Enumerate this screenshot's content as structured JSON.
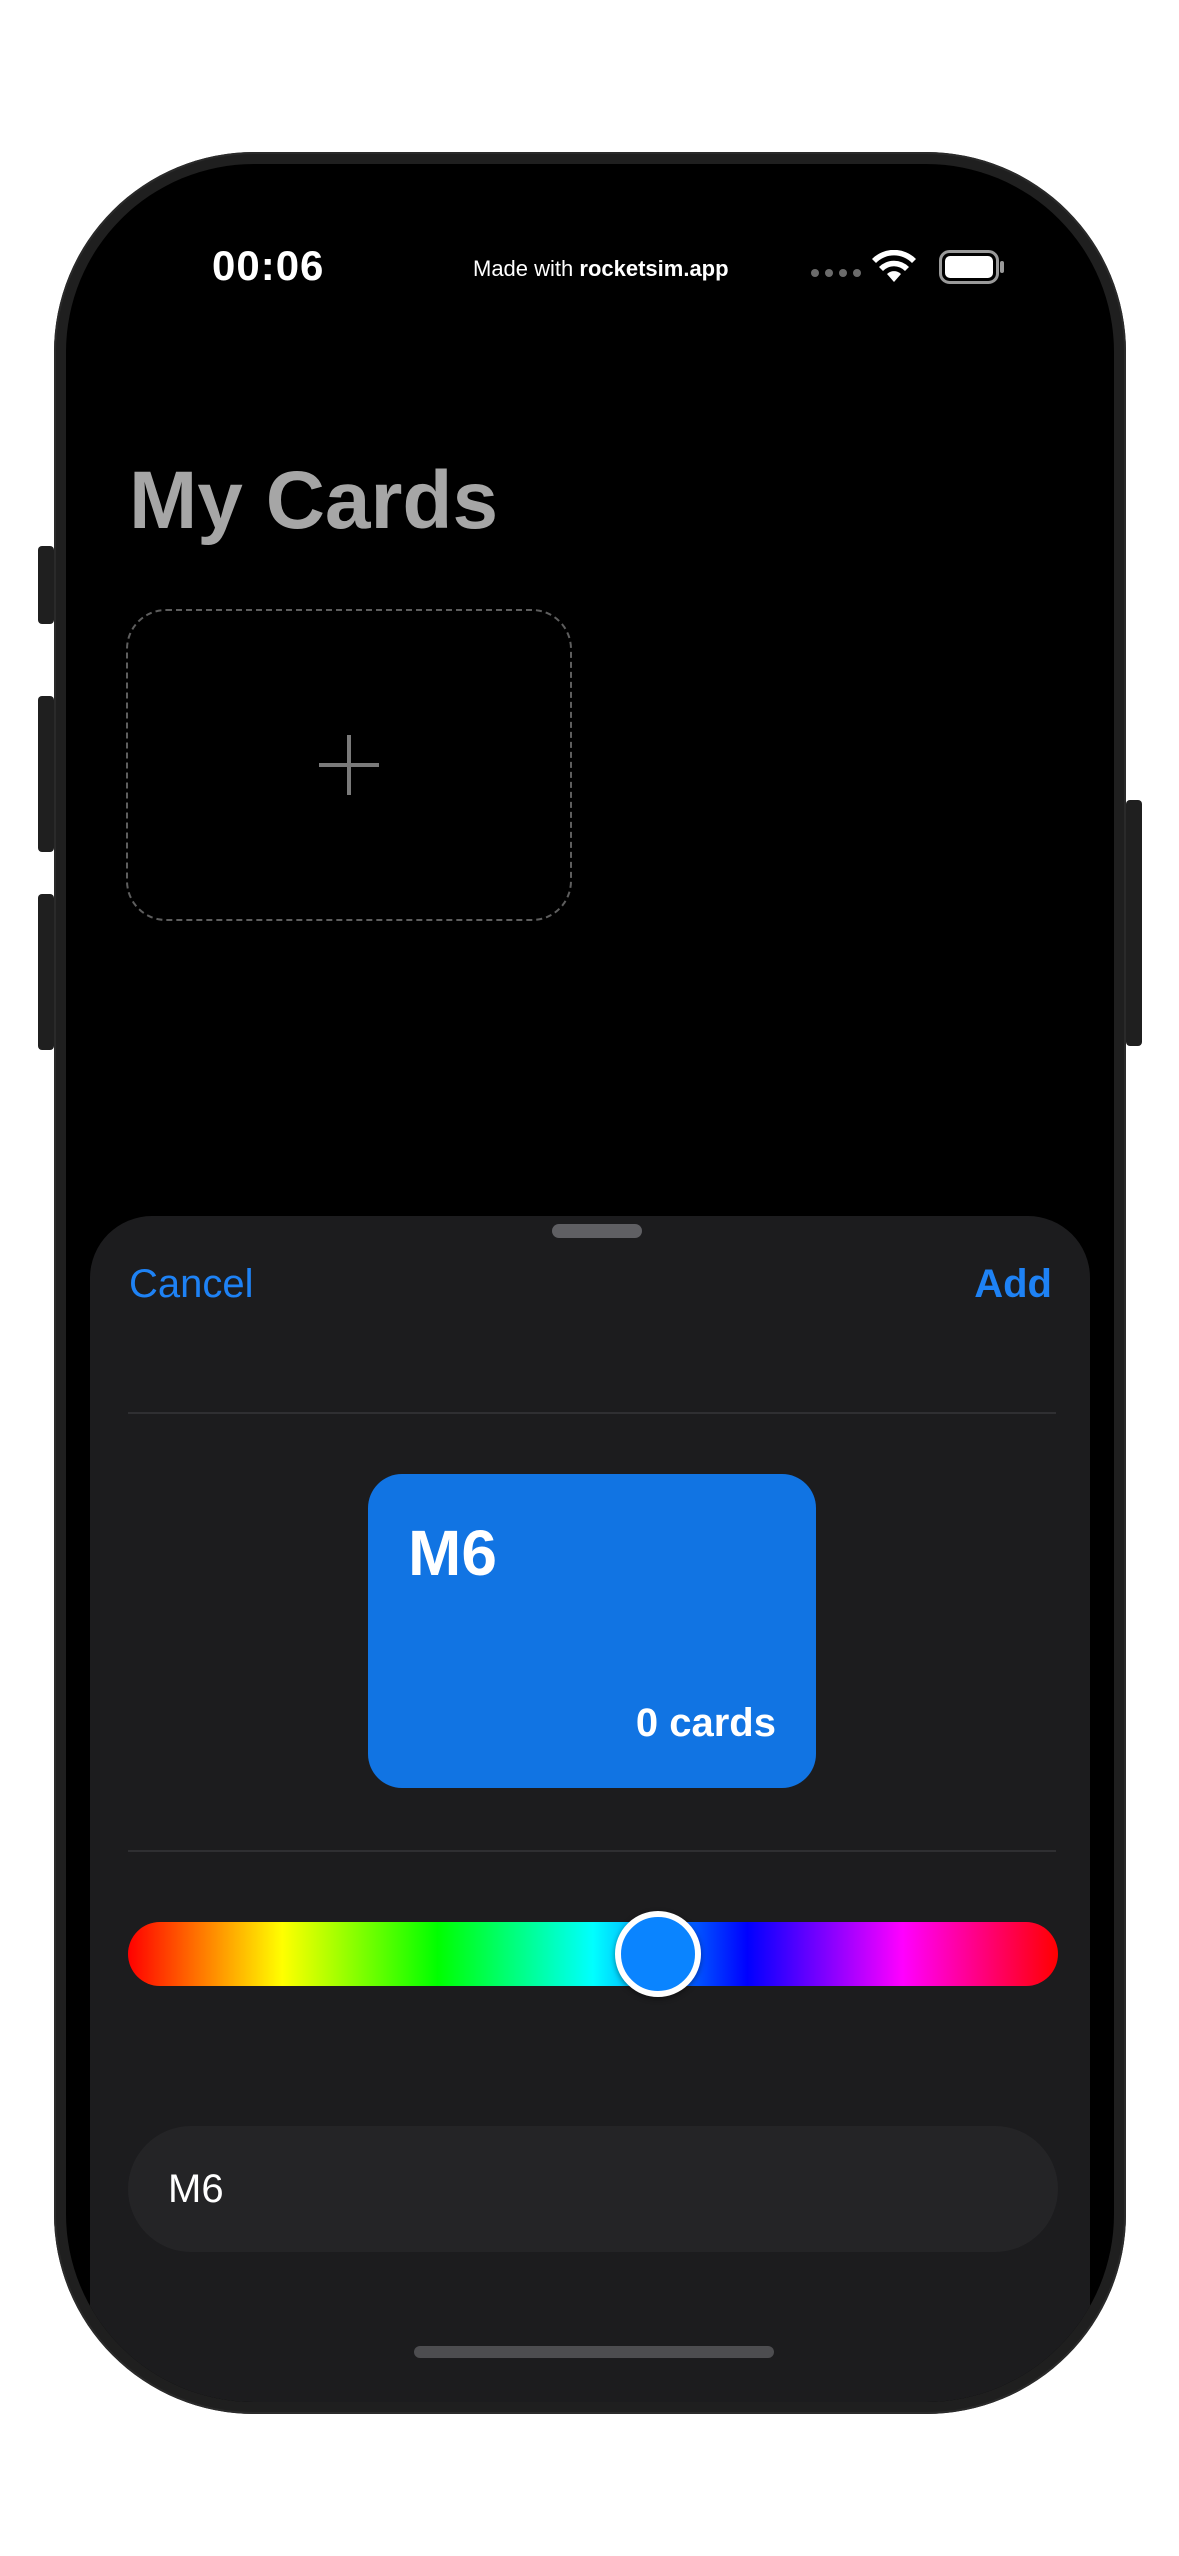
{
  "status_bar": {
    "time": "00:06",
    "made_with_prefix": "Made with ",
    "made_with_brand": "rocketsim.app"
  },
  "page": {
    "title": "My Cards"
  },
  "sheet": {
    "cancel_label": "Cancel",
    "add_label": "Add",
    "preview": {
      "title": "M6",
      "count": "0 cards"
    },
    "hue_slider": {
      "value": 0.57
    },
    "name_field_value": "M6"
  },
  "colors": {
    "accent": "#1e82f5",
    "card_color": "#1174e3",
    "thumb_color": "#0a84ff",
    "sheet_background": "#1c1c1e",
    "screen_background": "#000000"
  },
  "icons": {
    "add_card": "plus-icon",
    "wifi": "wifi-icon",
    "battery": "battery-icon"
  }
}
